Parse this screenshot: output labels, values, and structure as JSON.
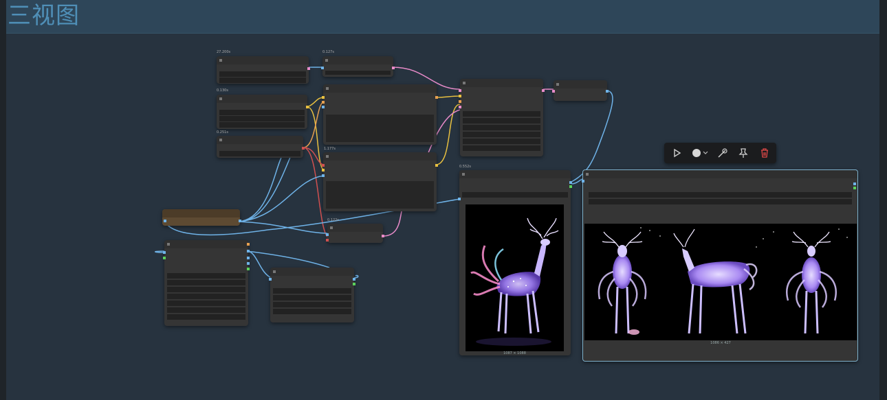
{
  "group": {
    "title": "三视图"
  },
  "nodes": {
    "n1": {
      "time": "27.200s"
    },
    "n2": {
      "time": "0.127s"
    },
    "n3": {
      "time": "0.130s"
    },
    "n4": {
      "time": "0.251s"
    },
    "n5": {
      "time": "1.177s"
    },
    "n6": {
      "time": "0.122s"
    },
    "n7": {
      "time": "0.552s"
    }
  },
  "preview_small": {
    "size_label": "1087 × 1088"
  },
  "preview_large": {
    "size_label": "1086 × 427"
  },
  "toolbar": {
    "run_icon": "play-icon",
    "color_icon": "color-circle-icon",
    "bypass_icon": "bypass-wand-icon",
    "pin_icon": "pin-icon",
    "delete_icon": "trash-icon",
    "delete_color": "#e04848"
  },
  "colors": {
    "wire_blue": "#6fb3e8",
    "wire_pink": "#e88bc9",
    "wire_yellow": "#e8c040",
    "wire_orange": "#e8a050",
    "wire_red": "#d05050",
    "selected_border": "#7fb2cc"
  }
}
